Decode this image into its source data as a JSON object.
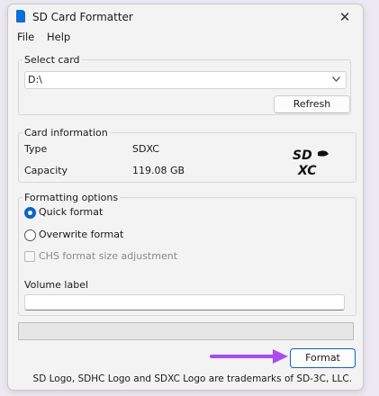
{
  "window": {
    "title": "SD Card Formatter",
    "close_symbol": "✕"
  },
  "menu": {
    "items": [
      "File",
      "Help"
    ]
  },
  "select_card": {
    "legend": "Select card",
    "drive_value": "D:\\",
    "refresh_label": "Refresh"
  },
  "card_information": {
    "legend": "Card information",
    "type_label": "Type",
    "type_value": "SDXC",
    "capacity_label": "Capacity",
    "capacity_value": "119.08 GB",
    "logo_text": "SDXC"
  },
  "formatting_options": {
    "legend": "Formatting options",
    "quick_format_label": "Quick format",
    "quick_format_selected": true,
    "overwrite_format_label": "Overwrite format",
    "overwrite_format_selected": false,
    "chs_label": "CHS format size adjustment",
    "chs_checked": false,
    "chs_enabled": false,
    "volume_label_label": "Volume label",
    "volume_label_value": ""
  },
  "progress": {
    "value": 0
  },
  "format_button_label": "Format",
  "footer_text": "SD Logo, SDHC Logo and SDXC Logo are trademarks of SD-3C, LLC.",
  "colors": {
    "accent": "#0a63c9",
    "annotation_arrow": "#a74ef2"
  }
}
